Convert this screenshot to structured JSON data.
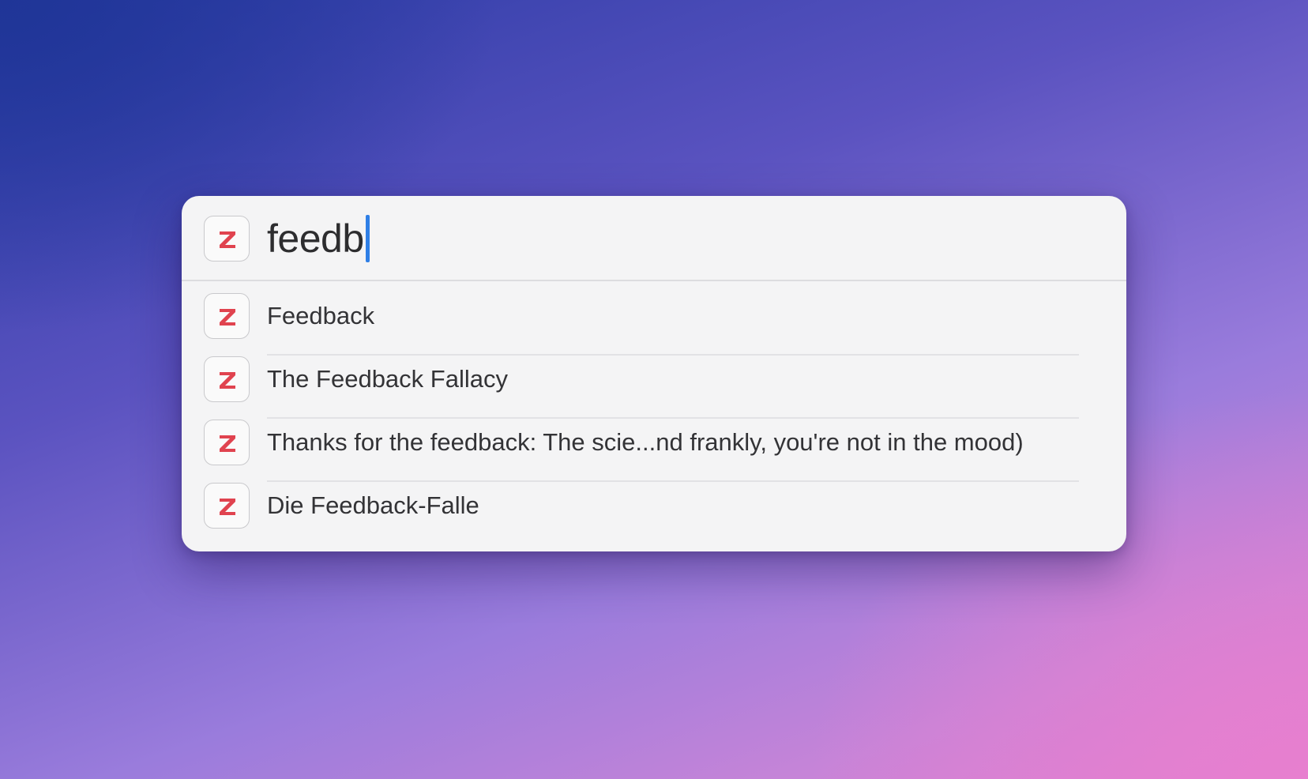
{
  "search": {
    "query": "feedb"
  },
  "results": [
    {
      "label": "Feedback"
    },
    {
      "label": "The Feedback Fallacy"
    },
    {
      "label": "Thanks for the feedback: The scie...nd frankly, you're not in the mood)"
    },
    {
      "label": "Die Feedback-Falle"
    }
  ],
  "colors": {
    "icon_accent": "#e0434f",
    "caret": "#2f7fe6",
    "panel_background": "#f4f4f5"
  },
  "icons": {
    "app": "zotero-z-icon"
  }
}
